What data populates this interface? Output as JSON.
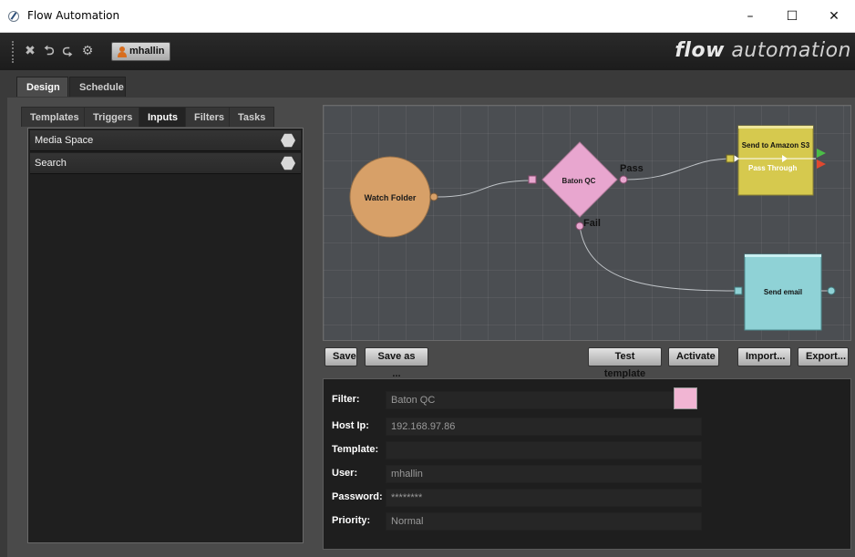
{
  "window": {
    "title": "Flow Automation",
    "minimize": "–",
    "maximize": "☐",
    "close": "✕"
  },
  "toolbar": {
    "user": "mhallin",
    "brand_bold": "flow",
    "brand_light": "automation"
  },
  "tabs": [
    {
      "label": "Design",
      "active": true
    },
    {
      "label": "Schedule",
      "active": false
    }
  ],
  "left_panel": {
    "subtabs": [
      {
        "label": "Templates",
        "active": false
      },
      {
        "label": "Triggers",
        "active": false
      },
      {
        "label": "Inputs",
        "active": true
      },
      {
        "label": "Filters",
        "active": false
      },
      {
        "label": "Tasks",
        "active": false
      }
    ],
    "items": [
      {
        "label": "Media Space"
      },
      {
        "label": "Search"
      }
    ]
  },
  "canvas": {
    "nodes": {
      "watch_folder": {
        "label": "Watch Folder",
        "color": "#d7a068"
      },
      "baton_qc": {
        "label": "Baton QC",
        "color": "#e8a6cf",
        "pass_label": "Pass",
        "fail_label": "Fail"
      },
      "send_s3": {
        "label": "Send to Amazon S3",
        "sublabel": "Pass Through",
        "color": "#d6c94e"
      },
      "send_email": {
        "label": "Send email",
        "color": "#8fd2d6"
      }
    }
  },
  "actions": {
    "save": "Save",
    "save_as": "Save as ...",
    "test_template": "Test template",
    "activate": "Activate",
    "import": "Import...",
    "export": "Export..."
  },
  "properties": {
    "filter": {
      "label": "Filter:",
      "value": "Baton QC",
      "color": "#f1b5d3"
    },
    "host_ip": {
      "label": "Host Ip:",
      "value": "192.168.97.86"
    },
    "template": {
      "label": "Template:",
      "value": ""
    },
    "user": {
      "label": "User:",
      "value": "mhallin"
    },
    "password": {
      "label": "Password:",
      "value": "********"
    },
    "priority": {
      "label": "Priority:",
      "value": "Normal"
    }
  }
}
